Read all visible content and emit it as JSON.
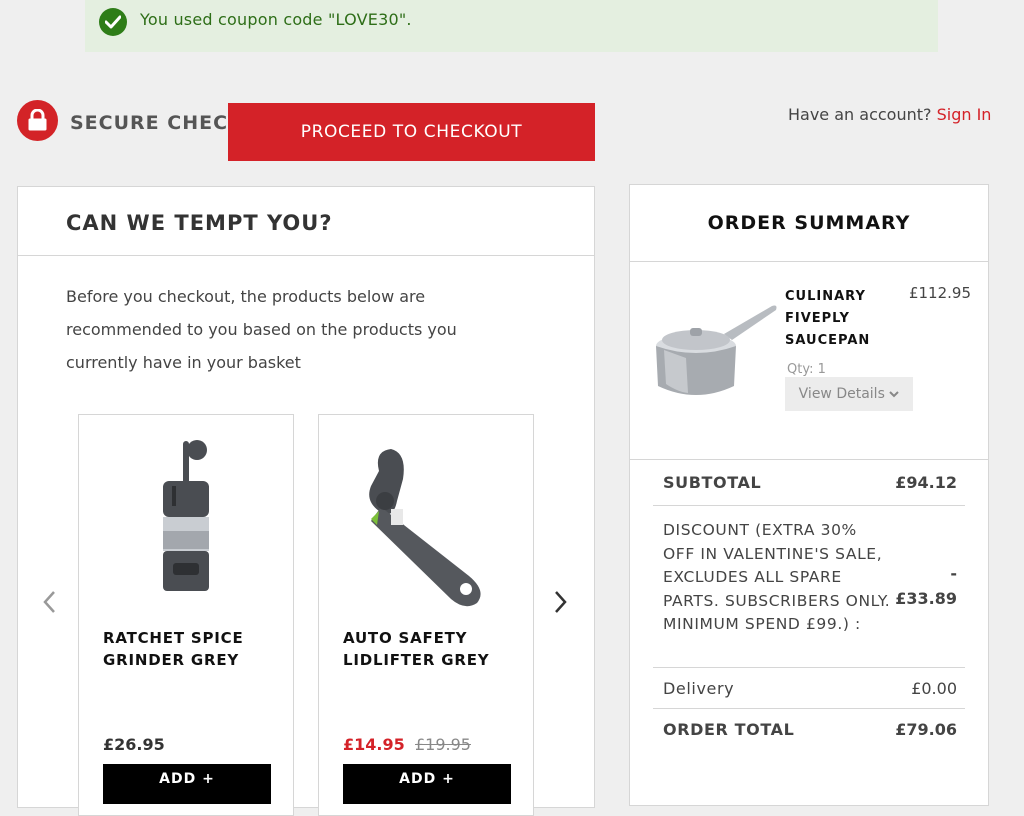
{
  "coupon": {
    "message": "You used coupon code \"LOVE30\"."
  },
  "header": {
    "secure_title": "SECURE CHECKOUT",
    "proceed_label": "PROCEED TO CHECKOUT",
    "account_prompt": "Have an account?",
    "sign_in_label": "Sign In"
  },
  "tempt": {
    "title": "CAN WE TEMPT YOU?",
    "intro": "Before you checkout, the products below are recommended to you based on the products you currently have in your basket",
    "products": [
      {
        "name": "RATCHET SPICE GRINDER GREY",
        "price": "£26.95",
        "add_label": "ADD +"
      },
      {
        "name": "AUTO SAFETY LIDLIFTER GREY",
        "price": "£14.95",
        "was_price": "£19.95",
        "add_label": "ADD +"
      }
    ]
  },
  "summary": {
    "title": "ORDER SUMMARY",
    "item": {
      "name": "CULINARY FIVEPLY SAUCEPAN",
      "price": "£112.95",
      "qty_label": "Qty:",
      "qty_value": "1",
      "details_label": "View Details"
    },
    "subtotal_label": "SUBTOTAL",
    "subtotal_value": "£94.12",
    "discount_label": "DISCOUNT (EXTRA 30% OFF IN VALENTINE'S SALE, EXCLUDES ALL SPARE PARTS. SUBSCRIBERS ONLY. MINIMUM SPEND £99.)  :",
    "discount_sign": "-",
    "discount_value": "£33.89",
    "delivery_label": "Delivery",
    "delivery_value": "£0.00",
    "total_label": "ORDER TOTAL",
    "total_value": "£79.06"
  },
  "colors": {
    "brand_red": "#d42228",
    "success_green": "#2e7d18",
    "banner_bg": "#e4efe0"
  }
}
